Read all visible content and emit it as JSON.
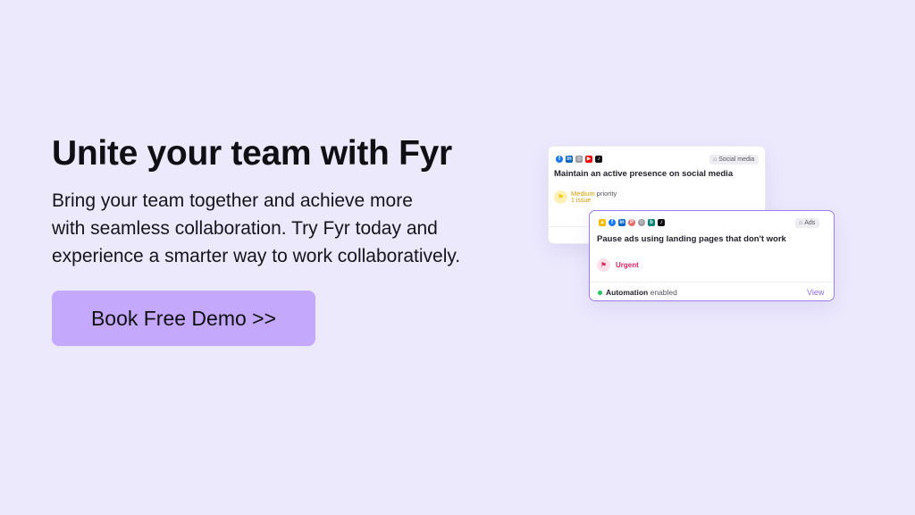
{
  "hero": {
    "title": "Unite your team with Fyr",
    "body_lines": [
      "Bring your team together and achieve more",
      "with seamless collaboration. Try Fyr today and",
      "experience a smarter way to work collaboratively."
    ],
    "cta_label": "Book Free Demo >>"
  },
  "cards": {
    "social": {
      "icons": [
        {
          "name": "facebook-icon",
          "glyph": "f",
          "color": "#1877f2"
        },
        {
          "name": "linkedin-icon",
          "glyph": "in",
          "color": "#0a66c2"
        },
        {
          "name": "instagram-icon",
          "glyph": "◎",
          "color": "#9a9aa2"
        },
        {
          "name": "youtube-icon",
          "glyph": "▶",
          "color": "#ff0000"
        },
        {
          "name": "tiktok-icon",
          "glyph": "♪",
          "color": "#111111"
        }
      ],
      "tag": "Social media",
      "title": "Maintain an active presence on social media",
      "priority_level": "Medium",
      "priority_word": "priority",
      "issue_count": "1 issue"
    },
    "ads": {
      "icons": [
        {
          "name": "google-ads-icon",
          "glyph": "▲",
          "color": "#fbbc04"
        },
        {
          "name": "facebook-icon",
          "glyph": "f",
          "color": "#1877f2"
        },
        {
          "name": "linkedin-icon",
          "glyph": "in",
          "color": "#0a66c2"
        },
        {
          "name": "pinterest-icon",
          "glyph": "P",
          "color": "#e86a6a"
        },
        {
          "name": "snapchat-icon",
          "glyph": "☺",
          "color": "#9a9aa2"
        },
        {
          "name": "bing-icon",
          "glyph": "b",
          "color": "#008373"
        },
        {
          "name": "tiktok-icon",
          "glyph": "♪",
          "color": "#111111"
        }
      ],
      "tag": "Ads",
      "title": "Pause ads using landing pages that don't work",
      "priority_label": "Urgent",
      "automation_strong": "Automation",
      "automation_rest": "enabled",
      "view_label": "View"
    }
  },
  "colors": {
    "background": "#ece9fd",
    "cta": "#c3a8fb",
    "medium_flag": "#f6c90e",
    "urgent_flag": "#e0245e",
    "accent": "#9b7cf2",
    "automation_dot": "#22c55e"
  }
}
